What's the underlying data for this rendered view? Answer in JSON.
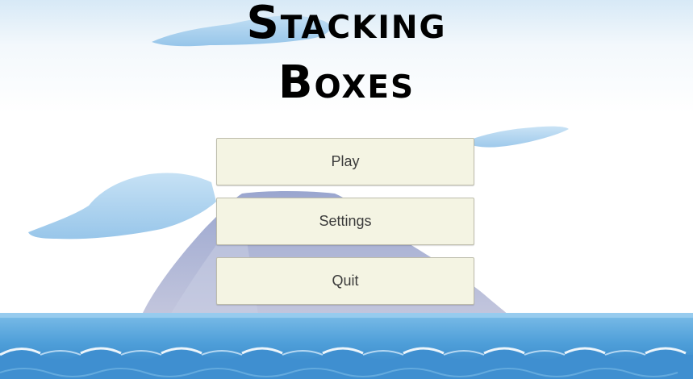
{
  "title": {
    "line1": "Stacking",
    "line2": "Boxes"
  },
  "menu": {
    "play_label": "Play",
    "settings_label": "Settings",
    "quit_label": "Quit"
  },
  "colors": {
    "sky_top": "#dcecf7",
    "sky_bottom": "#ffffff",
    "sea": "#5aa6dc",
    "sea_deep": "#2e7cc2",
    "island": "#a9b1d3",
    "button_bg": "#f4f4e3"
  }
}
